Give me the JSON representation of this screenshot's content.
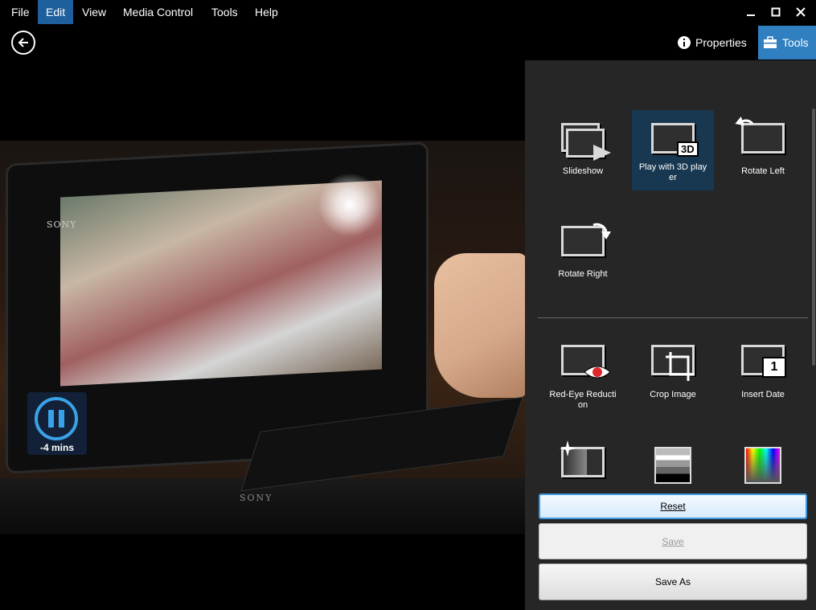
{
  "menu": {
    "items": [
      "File",
      "Edit",
      "View",
      "Media Control",
      "Tools",
      "Help"
    ],
    "active": "Edit"
  },
  "header": {
    "properties_label": "Properties",
    "tools_label": "Tools"
  },
  "photo": {
    "brand_top": "SONY",
    "brand_bottom": "SONY"
  },
  "playback": {
    "time_remaining": "-4 mins"
  },
  "tools": {
    "slideshow": "Slideshow",
    "play3d": "Play with 3D play\ner",
    "play3d_badge": "3D",
    "rotate_left": "Rotate Left",
    "rotate_right": "Rotate Right",
    "red_eye": "Red-Eye Reducti\non",
    "crop": "Crop Image",
    "insert_date": "Insert Date",
    "insert_date_badge": "1"
  },
  "actions": {
    "reset_label": "Reset",
    "save_label": "Save",
    "saveas_label": "Save As"
  },
  "colors": {
    "accent": "#2f7fc1",
    "menu_active": "#1e5f9e",
    "panel_bg": "#262626",
    "play_ring": "#3aa3e8"
  }
}
